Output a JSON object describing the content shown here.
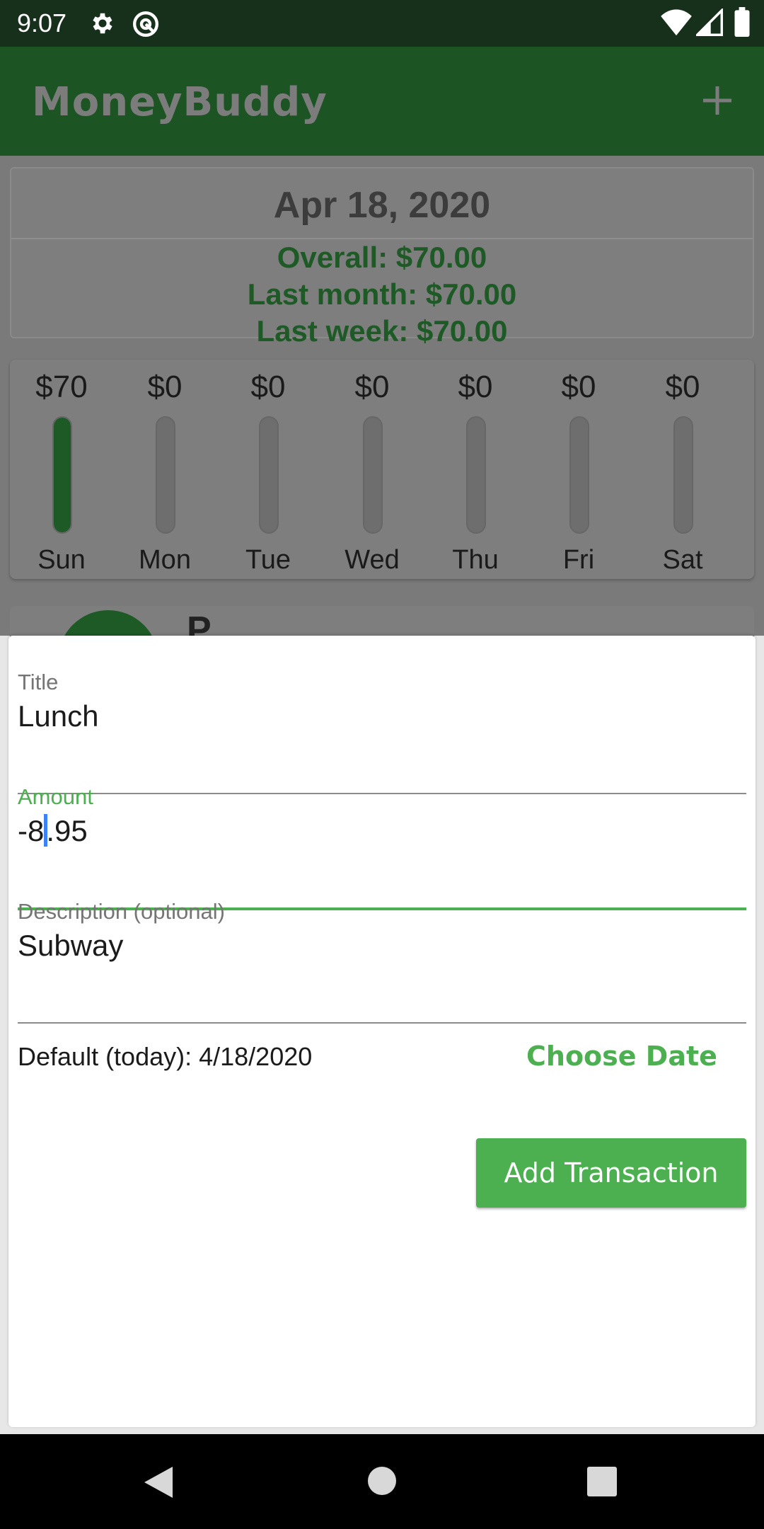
{
  "status_bar": {
    "time": "9:07",
    "icons": [
      "settings-gear-icon",
      "at-sign-icon",
      "wifi-icon",
      "signal-icon",
      "battery-icon"
    ]
  },
  "app_bar": {
    "title": "MoneyBuddy",
    "add_icon": "plus-icon"
  },
  "summary": {
    "date": "Apr 18, 2020",
    "overall": "Overall: $70.00",
    "last_month": "Last month: $70.00",
    "last_week": "Last week: $70.00"
  },
  "week_chart": {
    "days": [
      {
        "amount": "$70",
        "label": "Sun",
        "fill_fraction": 1.0
      },
      {
        "amount": "$0",
        "label": "Mon",
        "fill_fraction": 0
      },
      {
        "amount": "$0",
        "label": "Tue",
        "fill_fraction": 0
      },
      {
        "amount": "$0",
        "label": "Wed",
        "fill_fraction": 0
      },
      {
        "amount": "$0",
        "label": "Thu",
        "fill_fraction": 0
      },
      {
        "amount": "$0",
        "label": "Fri",
        "fill_fraction": 0
      },
      {
        "amount": "$0",
        "label": "Sat",
        "fill_fraction": 0
      }
    ]
  },
  "peek": {
    "letter": "P"
  },
  "form": {
    "title_label": "Title",
    "title_value": "Lunch",
    "amount_label": "Amount",
    "amount_before_caret": "-8",
    "amount_after_caret": ".95",
    "description_label": "Description (optional)",
    "description_value": "Subway",
    "default_date": "Default (today): 4/18/2020",
    "choose_date": "Choose Date",
    "submit": "Add Transaction"
  },
  "colors": {
    "accent": "#4caf50",
    "app_bar": "#1c5424",
    "status_bar": "#17301b",
    "caret": "#3b82f6"
  },
  "nav_bar": {
    "icons": [
      "back-icon",
      "home-icon",
      "recents-icon"
    ]
  }
}
